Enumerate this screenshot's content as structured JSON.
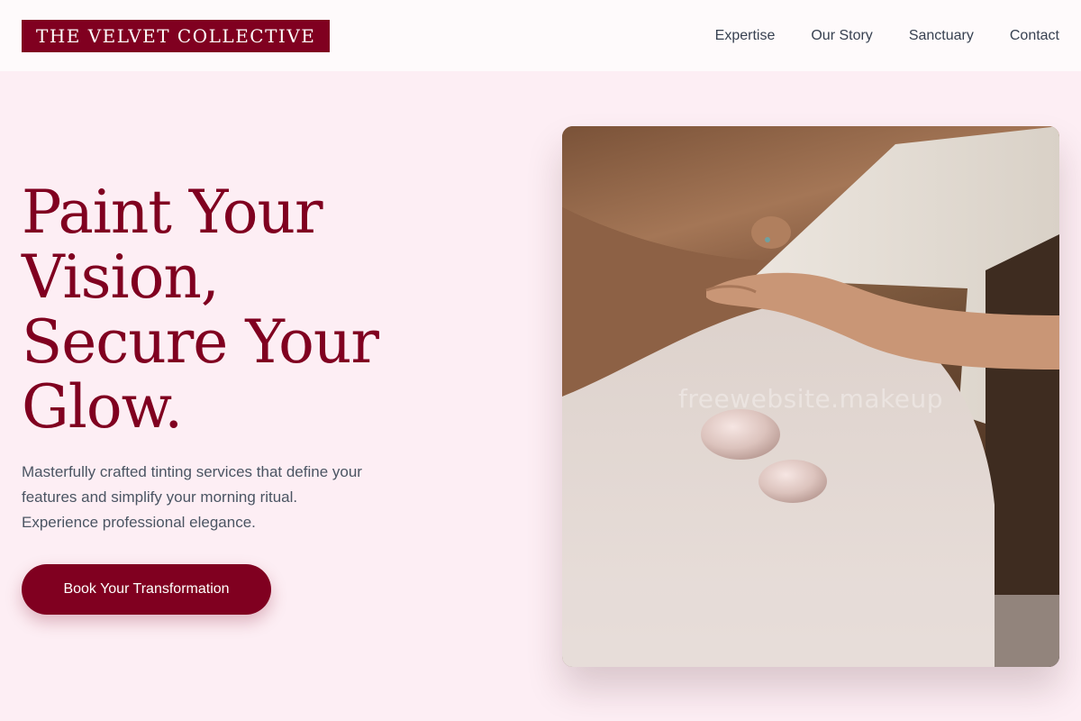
{
  "brand": {
    "name": "THE VELVET COLLECTIVE"
  },
  "nav": {
    "items": [
      {
        "label": "Expertise"
      },
      {
        "label": "Our Story"
      },
      {
        "label": "Sanctuary"
      },
      {
        "label": "Contact"
      }
    ]
  },
  "hero": {
    "title_lines": [
      "Paint Your",
      "Vision,",
      "Secure Your",
      "Glow."
    ],
    "description_lines": [
      "Masterfully crafted tinting services that define your",
      "features and simplify your morning ritual.",
      "Experience professional elegance."
    ],
    "cta_label": "Book Your Transformation",
    "image_watermark": "freewebsite.makeup"
  },
  "colors": {
    "accent": "#800020",
    "page_background": "#fdeef4",
    "header_background": "#fefafb",
    "body_text": "#4b5563"
  }
}
